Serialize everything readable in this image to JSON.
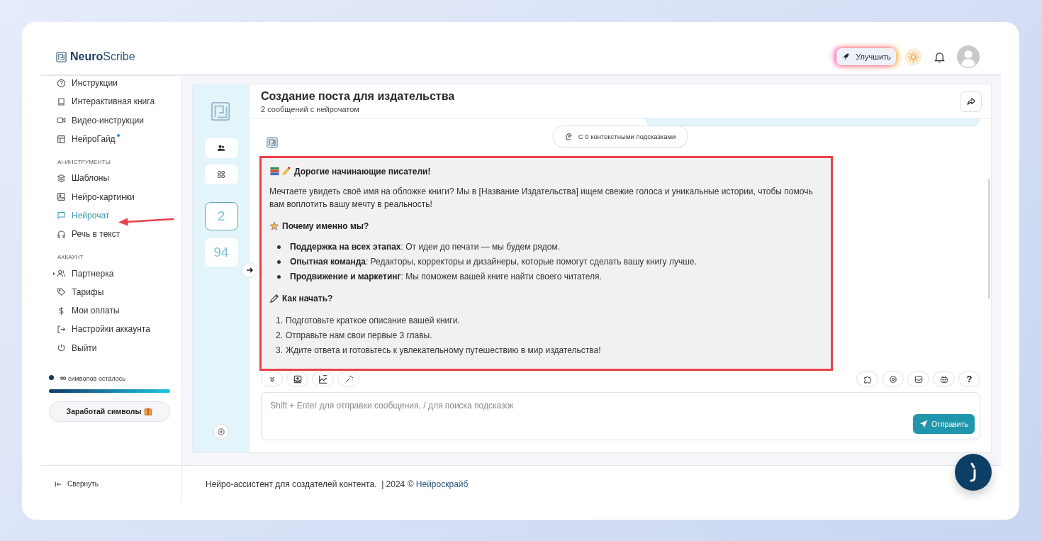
{
  "brand": {
    "bold": "Neuro",
    "rest": "Scribe"
  },
  "header": {
    "upgrade_label": "Улучшить"
  },
  "sidebar": {
    "top_items": [
      {
        "label": "Инструкции",
        "selected": false,
        "dot": false
      },
      {
        "label": "Интерактивная книга",
        "selected": false,
        "dot": false
      },
      {
        "label": "Видео-инструкции",
        "selected": false,
        "dot": false
      },
      {
        "label": "НейроГайд",
        "selected": false,
        "dot": true
      }
    ],
    "sections": [
      {
        "heading": "AI-ИНСТРУМЕНТЫ",
        "items": [
          {
            "label": "Шаблоны",
            "selected": false,
            "kind": "link"
          },
          {
            "label": "Нейро-картинки",
            "selected": false,
            "kind": "link"
          },
          {
            "label": "Нейрочат",
            "selected": true,
            "kind": "link"
          },
          {
            "label": "Речь в текст",
            "selected": false,
            "kind": "link"
          }
        ]
      },
      {
        "heading": "АККАУНТ",
        "items": [
          {
            "label": "Партнерка",
            "selected": false,
            "kind": "group"
          },
          {
            "label": "Тарифы",
            "selected": false,
            "kind": "link"
          },
          {
            "label": "Мои оплаты",
            "selected": false,
            "kind": "link"
          },
          {
            "label": "Настройки аккаунта",
            "selected": false,
            "kind": "link"
          },
          {
            "label": "Выйти",
            "selected": false,
            "kind": "link"
          }
        ]
      }
    ],
    "usage": {
      "amount": "∞",
      "label": "символов осталось",
      "level": 1.0
    },
    "earn_button": "Заработай символы",
    "collapse": "Свернуть"
  },
  "chat": {
    "title": "Создание поста для издательства",
    "subtitle": "2 сообщений с нейрочатом",
    "counts": [
      {
        "value": "2",
        "selected": true
      },
      {
        "value": "94",
        "selected": false
      }
    ],
    "context_chip": "С 0 контекстными подсказками",
    "message": {
      "highlighted": true,
      "heading": "Дорогие начинающие писатели!",
      "paragraph": "Мечтаете увидеть своё имя на обложке книги? Мы в [Название Издательства] ищем свежие голоса и уникальные истории, чтобы помочь вам воплотить вашу мечту в реальность!",
      "why_heading": "Почему именно мы?",
      "bullets": [
        "**Поддержка на всех этапах**: От идеи до печати — мы будем рядом.",
        "**Опытная команда**: Редакторы, корректоры и дизайнеры, которые помогут сделать вашу книгу лучше.",
        "**Продвижение и маркетинг**: Мы поможем вашей книге найти своего читателя."
      ],
      "start_heading": "Как начать?",
      "steps": [
        {
          "number": "1.",
          "text": "Подготовьте краткое описание вашей книги."
        },
        {
          "number": "2.",
          "text": "Отправьте нам свои первые 3 главы."
        },
        {
          "number": "3.",
          "text": "Ждите ответа и готовьтесь к увлекательному путешествию в мир издательства!"
        }
      ]
    },
    "help_label": "?",
    "input": {
      "placeholder": "Shift + Enter для отправки сообщения, / для поиска подсказок"
    },
    "send_label": "Отправить"
  },
  "footer": {
    "text": "Нейро-ассистент для создателей контента.  | 2024 ©",
    "link": "Нейроскрайб"
  }
}
